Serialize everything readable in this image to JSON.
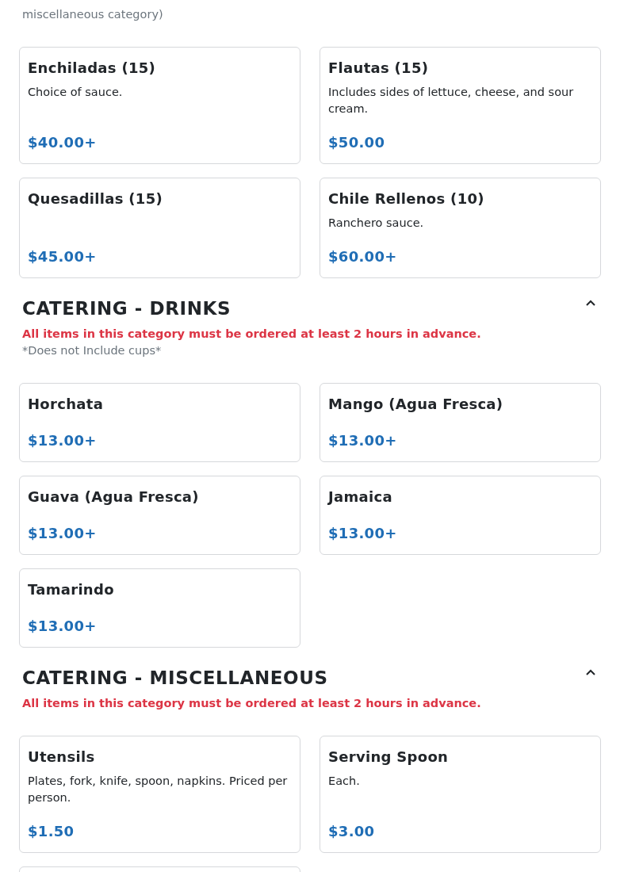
{
  "sections": [
    {
      "notes": [
        {
          "kind": "info",
          "text": "miscellaneous category)"
        }
      ],
      "items": [
        {
          "name": "Enchiladas (15)",
          "description": "Choice of sauce.",
          "price": "$40.00+"
        },
        {
          "name": "Flautas (15)",
          "description": "Includes sides of lettuce, cheese, and sour cream.",
          "price": "$50.00"
        },
        {
          "name": "Quesadillas (15)",
          "price": "$45.00+"
        },
        {
          "name": "Chile Rellenos (10)",
          "description": "Ranchero sauce.",
          "price": "$60.00+"
        }
      ]
    },
    {
      "title": "CATERING - DRINKS",
      "expanded": true,
      "notes": [
        {
          "kind": "warning",
          "text": "All items in this category must be ordered at least 2 hours in advance."
        },
        {
          "kind": "info",
          "text": "*Does not Include cups*"
        }
      ],
      "items": [
        {
          "name": "Horchata",
          "price": "$13.00+"
        },
        {
          "name": "Mango (Agua Fresca)",
          "price": "$13.00+"
        },
        {
          "name": "Guava (Agua Fresca)",
          "price": "$13.00+"
        },
        {
          "name": "Jamaica",
          "price": "$13.00+"
        },
        {
          "name": "Tamarindo",
          "price": "$13.00+"
        }
      ]
    },
    {
      "title": "CATERING - MISCELLANEOUS",
      "expanded": true,
      "notes": [
        {
          "kind": "warning",
          "text": "All items in this category must be ordered at least 2 hours in advance."
        }
      ],
      "items": [
        {
          "name": "Utensils",
          "description": "Plates, fork, knife, spoon, napkins. Priced per person.",
          "price": "$1.50"
        },
        {
          "name": "Serving Spoon",
          "description": "Each.",
          "price": "$3.00"
        }
      ],
      "continues": true
    }
  ]
}
